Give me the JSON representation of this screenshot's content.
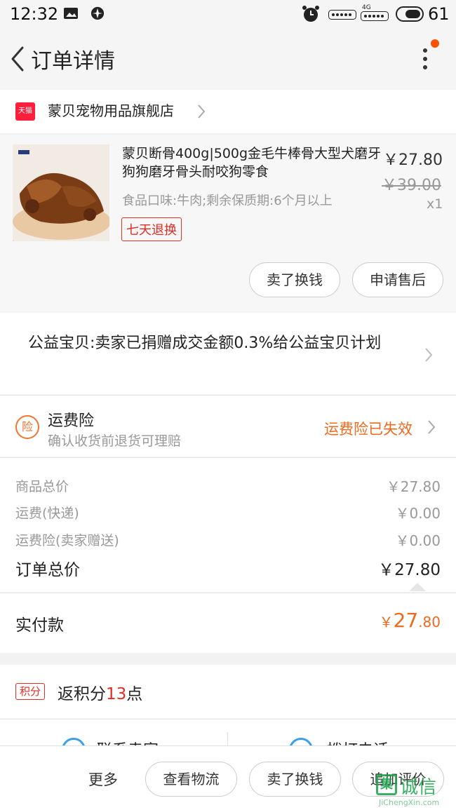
{
  "status_bar": {
    "time": "12:32",
    "network": "4G",
    "battery": "61",
    "icons": [
      "image-icon",
      "app-icon",
      "alarm-icon",
      "signal-icon",
      "4g-signal-icon",
      "battery-icon"
    ]
  },
  "header": {
    "title": "订单详情",
    "back_icon": "back-arrow-icon",
    "menu_icon": "more-vertical-icon",
    "badge_color": "#ff5000"
  },
  "store": {
    "logo": "天猫",
    "name": "蒙贝宠物用品旗舰店"
  },
  "product": {
    "title": "蒙贝断骨400g|500g金毛牛棒骨大型犬磨牙狗狗磨牙骨头耐咬狗零食",
    "price": "￥27.80",
    "original_price": "￥39.00",
    "quantity": "x1",
    "spec": "食品口味:牛肉;剩余保质期:6个月以上",
    "badge": "七天退换",
    "buttons": {
      "sell": "卖了换钱",
      "after_sale": "申请售后"
    }
  },
  "charity": {
    "text": "公益宝贝:卖家已捐赠成交金额0.3%给公益宝贝计划"
  },
  "insurance": {
    "icon_char": "险",
    "title": "运费险",
    "subtitle": "确认收货前退货可理赔",
    "status": "运费险已失效"
  },
  "summary": {
    "rows": [
      {
        "label": "商品总价",
        "value": "￥27.80"
      },
      {
        "label": "运费(快递)",
        "value": "￥0.00"
      },
      {
        "label": "运费险(卖家赠送)",
        "value": "￥0.00"
      }
    ],
    "total_label": "订单总价",
    "total_value": "￥27.80"
  },
  "paid": {
    "label": "实付款",
    "currency": "￥",
    "integer": "27",
    "decimal": ".80"
  },
  "points": {
    "badge": "积分",
    "prefix": "返积分",
    "number": "13",
    "suffix": "点"
  },
  "contact": {
    "seller": "联系卖家",
    "call": "拨打电话"
  },
  "bottom_bar": {
    "more": "更多",
    "logistics": "查看物流",
    "sell": "卖了换钱",
    "review": "追加评价"
  },
  "watermark": {
    "mark": "集",
    "cn": "诚信",
    "en": "JiChengXin.com"
  },
  "colors": {
    "accent": "#ee6a1e",
    "tmall_red": "#ff1e3c",
    "badge_red": "#e02e24",
    "contact_blue": "#3aa0e8"
  }
}
